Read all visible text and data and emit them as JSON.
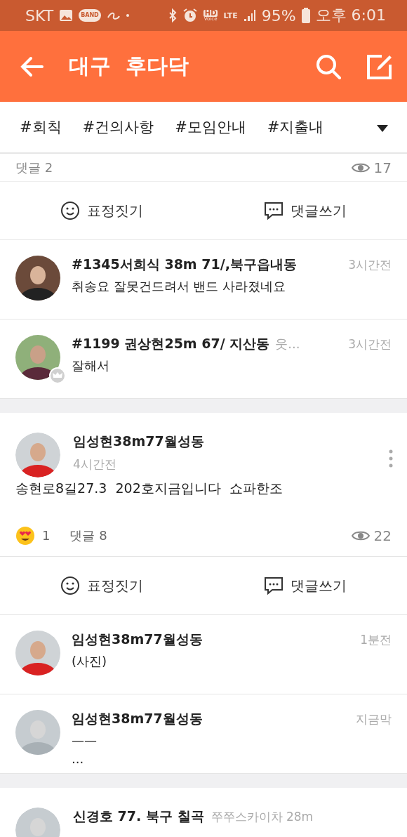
{
  "status_bar": {
    "carrier": "SKT",
    "app_badge": "BAND",
    "hd_label": "HD",
    "voice_label": "Voice",
    "network": "LTE",
    "battery": "95%",
    "time": "오후 6:01"
  },
  "app_bar": {
    "title": "대구  후다닥"
  },
  "tags": [
    {
      "label": "#회칙"
    },
    {
      "label": "#건의사항"
    },
    {
      "label": "#모임안내"
    },
    {
      "label": "#지출내"
    }
  ],
  "feed": [
    {
      "kind": "footer",
      "comments": "댓글 2",
      "views": "17"
    },
    {
      "kind": "actions",
      "react": "표정짓기",
      "comment": "댓글쓰기"
    },
    {
      "kind": "comment",
      "author": "#1345서희식 38m 71/,북구읍내동",
      "time": "3시간전",
      "lines": [
        "취송요 잘못건드려서 밴드 사라졌네요"
      ],
      "crown": false
    },
    {
      "kind": "comment",
      "author": "#1199 권상현25m  67/ 지산동",
      "extra": "웃...",
      "time": "3시간전",
      "lines": [
        "잘해서"
      ],
      "crown": true
    },
    {
      "kind": "gap"
    },
    {
      "kind": "post_header",
      "author": "임성현38m77월성동",
      "time": "4시간전"
    },
    {
      "kind": "body",
      "text": "송현로8길27.3  202호지금입니다  쇼파한조"
    },
    {
      "kind": "stats",
      "reactions": "1",
      "comments": "댓글 8",
      "views": "22"
    },
    {
      "kind": "actions",
      "react": "표정짓기",
      "comment": "댓글쓰기"
    },
    {
      "kind": "comment",
      "author": "임성현38m77월성동",
      "time": "1분전",
      "lines": [
        "(사진)"
      ],
      "crown": false
    },
    {
      "kind": "comment",
      "author": "임성현38m77월성동",
      "time": "지금막",
      "lines": [
        "——",
        "..."
      ],
      "crown": false
    },
    {
      "kind": "gap"
    },
    {
      "kind": "post_header",
      "author": "신경호 77. 북구 칠곡",
      "extra": "쭈쭈스카이차 28m"
    }
  ]
}
